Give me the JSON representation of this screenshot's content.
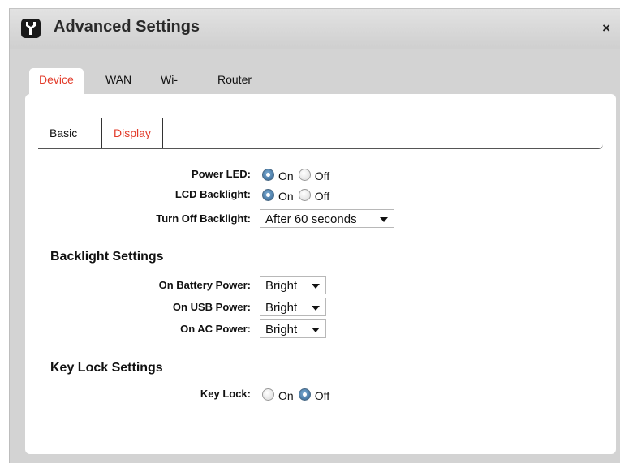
{
  "window": {
    "title": "Advanced Settings",
    "close": "×"
  },
  "tabs": [
    {
      "label": "Device",
      "active": true
    },
    {
      "label": "WAN",
      "active": false
    },
    {
      "label": "Wi-Fi",
      "active": false
    },
    {
      "label": "Router",
      "active": false
    }
  ],
  "subtabs": [
    {
      "label": "Basic",
      "active": false
    },
    {
      "label": "Display",
      "active": true
    }
  ],
  "display": {
    "power_led": {
      "label": "Power LED:",
      "on": "On",
      "off": "Off",
      "selected": "On"
    },
    "lcd_backlight": {
      "label": "LCD Backlight:",
      "on": "On",
      "off": "Off",
      "selected": "On"
    },
    "turn_off_backlight": {
      "label": "Turn Off Backlight:",
      "value": "After 60 seconds"
    }
  },
  "backlight_settings": {
    "heading": "Backlight Settings",
    "battery": {
      "label": "On Battery Power:",
      "value": "Bright"
    },
    "usb": {
      "label": "On USB Power:",
      "value": "Bright"
    },
    "ac": {
      "label": "On AC Power:",
      "value": "Bright"
    }
  },
  "key_lock_settings": {
    "heading": "Key Lock Settings",
    "key_lock": {
      "label": "Key Lock:",
      "on": "On",
      "off": "Off",
      "selected": "Off"
    }
  },
  "colors": {
    "accent": "#e23b2a",
    "radio_selected": "#2f5f8c",
    "frame": "#d3d3d3"
  }
}
